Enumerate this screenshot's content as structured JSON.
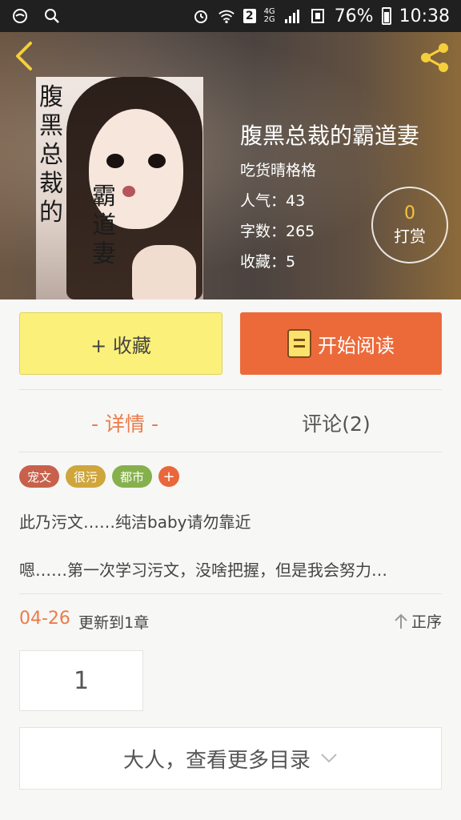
{
  "status_bar": {
    "battery": "76%",
    "time": "10:38",
    "sim_badge": "2",
    "network_top": "4G",
    "network_bottom": "2G"
  },
  "book": {
    "title": "腹黑总裁的霸道妻",
    "author": "吃货晴格格",
    "cover_text_left": "腹黑总裁的",
    "cover_text_right": "霸道妻",
    "stats": [
      {
        "label": "人气：43"
      },
      {
        "label": "字数：265"
      },
      {
        "label": "收藏：5"
      }
    ],
    "tip": {
      "count": "0",
      "label": "打赏"
    }
  },
  "actions": {
    "collect_label": "+ 收藏",
    "read_label": "开始阅读"
  },
  "tabs": {
    "detail": "- 详情 -",
    "comments": "评论(2)"
  },
  "tags": [
    {
      "label": "宠文",
      "color": "#c8614c"
    },
    {
      "label": "很污",
      "color": "#cfa63c"
    },
    {
      "label": "都市",
      "color": "#86b04c"
    }
  ],
  "tag_add": "+",
  "description": {
    "line1": "此乃污文……纯洁baby请勿靠近",
    "line2": "嗯……第一次学习污文，没啥把握，但是我会努力…"
  },
  "update": {
    "date": "04-26",
    "text": "更新到1章",
    "sort_label": "正序"
  },
  "chapter_number": "1",
  "more_catalog": "大人，查看更多目录",
  "colors": {
    "accent": "#ec6a3a",
    "collect_bg": "#fbf17a"
  }
}
